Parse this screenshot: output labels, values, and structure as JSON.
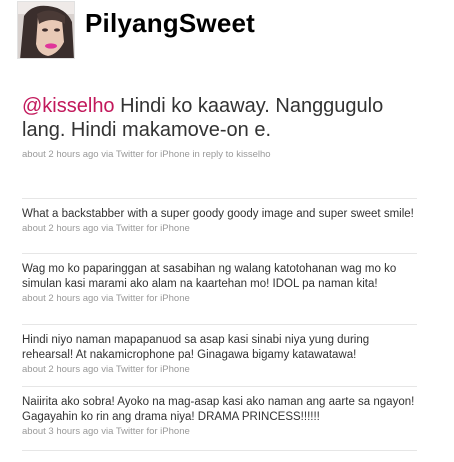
{
  "profile": {
    "screen_name": "PilyangSweet",
    "avatar_icon": "user-avatar-photo"
  },
  "main_tweet": {
    "mention": "@kisselho",
    "text": " Hindi ko kaaway. Nanggugulo lang. Hindi makamove-on e.",
    "meta": "about 2 hours ago via Twitter for iPhone in reply to kisselho"
  },
  "tweets": [
    {
      "text": "What a backstabber with a super goody goody image and super sweet smile!",
      "meta": "about 2 hours ago via Twitter for iPhone"
    },
    {
      "text": "Wag mo ko paparinggan at sasabihan ng walang katotohanan wag mo ko simulan kasi marami ako alam na kaartehan mo! IDOL pa naman kita!",
      "meta": "about 2 hours ago via Twitter for iPhone"
    },
    {
      "text": "Hindi niyo naman mapapanuod sa asap kasi sinabi niya yung during rehearsal! At nakamicrophone pa! Ginagawa bigamy katawatawa!",
      "meta": "about 2 hours ago via Twitter for iPhone"
    },
    {
      "text": "Naiirita ako sobra! Ayoko na mag-asap kasi ako naman ang aarte sa ngayon! Gagayahin ko rin ang drama niya! DRAMA PRINCESS!!!!!!",
      "meta": "about 3 hours ago via Twitter for iPhone"
    }
  ],
  "colors": {
    "mention": "#c2185b",
    "text": "#333333",
    "meta": "#999999",
    "divider": "#e6e6e6"
  }
}
